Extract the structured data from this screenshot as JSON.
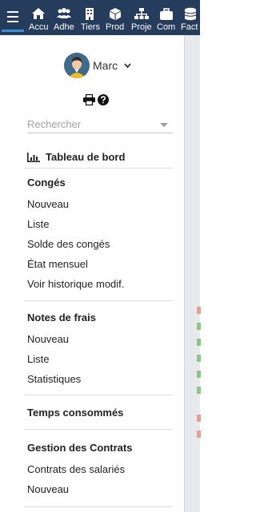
{
  "topbar": {
    "menus": [
      {
        "label": "Accu",
        "icon": "home-icon"
      },
      {
        "label": "Adhe",
        "icon": "users-icon"
      },
      {
        "label": "Tiers",
        "icon": "building-icon"
      },
      {
        "label": "Prod",
        "icon": "cube-icon"
      },
      {
        "label": "Proje",
        "icon": "sitemap-icon"
      },
      {
        "label": "Com",
        "icon": "briefcase-icon"
      },
      {
        "label": "Fact",
        "icon": "coins-icon"
      }
    ],
    "colors": {
      "background": "#263c5c",
      "accent": "#3f8dd1"
    }
  },
  "user": {
    "name": "Marc"
  },
  "search": {
    "placeholder": "Rechercher"
  },
  "menu": {
    "dashboard": "Tableau de bord",
    "conges": {
      "title": "Congés",
      "items": [
        "Nouveau",
        "Liste",
        "Solde des congés",
        "État mensuel",
        "Voir historique modif."
      ]
    },
    "notes": {
      "title": "Notes de frais",
      "items": [
        "Nouveau",
        "Liste",
        "Statistiques"
      ]
    },
    "temps": {
      "title": "Temps consommés"
    },
    "contrats": {
      "title": "Gestion des Contrats",
      "items": [
        "Contrats des salariés",
        "Nouveau"
      ]
    }
  }
}
